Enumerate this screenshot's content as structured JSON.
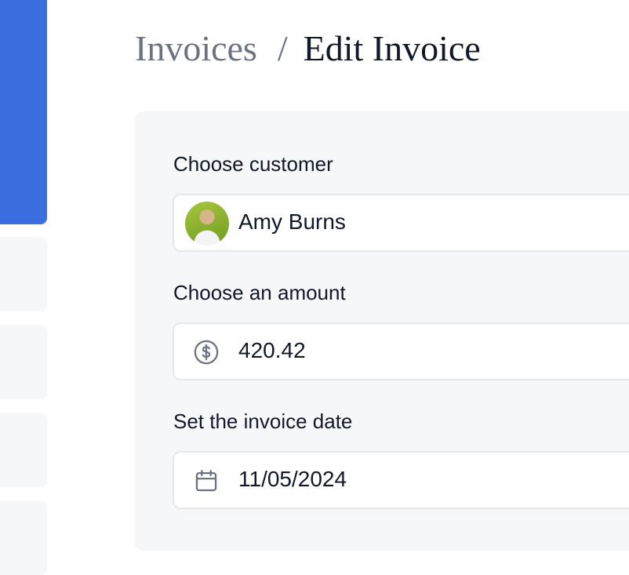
{
  "breadcrumb": {
    "parent": "Invoices",
    "separator": "/",
    "current": "Edit Invoice"
  },
  "form": {
    "customer": {
      "label": "Choose customer",
      "value": "Amy Burns",
      "avatar": "customer-avatar"
    },
    "amount": {
      "label": "Choose an amount",
      "value": "420.42",
      "icon": "dollar-circle-icon"
    },
    "date": {
      "label": "Set the invoice date",
      "value": "11/05/2024",
      "icon": "calendar-icon"
    }
  },
  "colors": {
    "accent": "#3b6fe0",
    "panel": "#f6f7f9",
    "border": "#e5e7eb",
    "muted_text": "#6b7280",
    "text": "#111827"
  }
}
